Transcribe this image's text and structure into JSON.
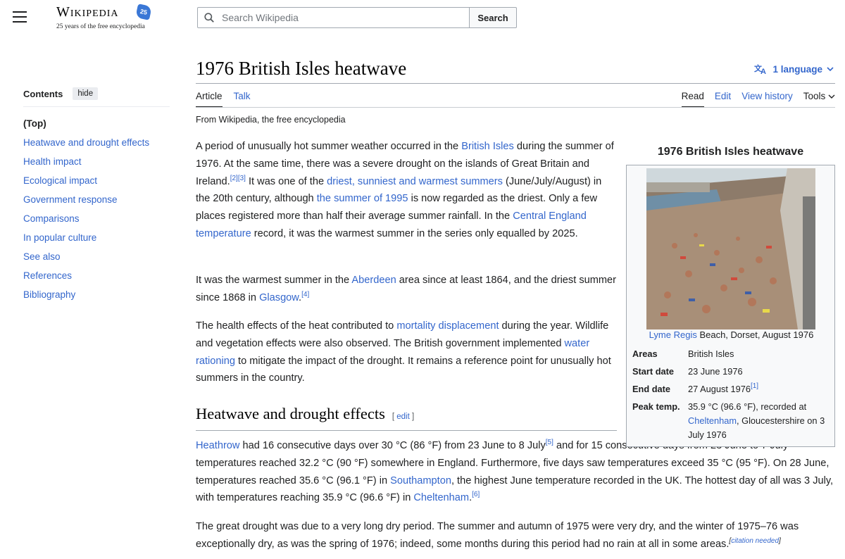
{
  "header": {
    "logo_word": "Wikipedia",
    "logo_badge": "25",
    "logo_tagline": "25 years of the free encyclopedia",
    "search_placeholder": "Search Wikipedia",
    "search_button": "Search"
  },
  "sidebar": {
    "contents_label": "Contents",
    "hide_label": "hide",
    "items": [
      {
        "label": "(Top)"
      },
      {
        "label": "Heatwave and drought effects"
      },
      {
        "label": "Health impact"
      },
      {
        "label": "Ecological impact"
      },
      {
        "label": "Government response"
      },
      {
        "label": "Comparisons"
      },
      {
        "label": "In popular culture"
      },
      {
        "label": "See also"
      },
      {
        "label": "References"
      },
      {
        "label": "Bibliography"
      }
    ]
  },
  "page": {
    "title": "1976 British Isles heatwave",
    "language_button": "1 language",
    "tabs_left": [
      "Article",
      "Talk"
    ],
    "tabs_right": [
      "Read",
      "Edit",
      "View history",
      "Tools"
    ],
    "tagline": "From Wikipedia, the free encyclopedia"
  },
  "article": {
    "p1": {
      "t1": "A period of unusually hot summer weather occurred in the ",
      "l1": "British Isles",
      "t2": " during the summer of 1976. At the same time, there was a severe drought on the islands of Great Britain and Ireland.",
      "s1": "[2]",
      "s2": "[3]",
      "t3": " It was one of the ",
      "l2": "driest, sunniest and warmest summers",
      "t4": " (June/July/August) in the 20th century, although ",
      "l3": "the summer of 1995",
      "t5": " is now regarded as the driest. Only a few places registered more than half their average summer rainfall. In the ",
      "l4": "Central England temperature",
      "t6": " record, it was the warmest summer in the series only equalled by 2025."
    },
    "p2": {
      "t1": "It was the warmest summer in the ",
      "l1": "Aberdeen",
      "t2": " area since at least 1864, and the driest summer since 1868 in ",
      "l2": "Glasgow",
      "t3": ".",
      "s1": "[4]"
    },
    "p3": {
      "t1": "The health effects of the heat contributed to ",
      "l1": "mortality displacement",
      "t2": " during the year. Wildlife and vegetation effects were also observed. The British government implemented ",
      "l2": "water rationing",
      "t3": " to mitigate the impact of the drought. It remains a reference point for unusually hot summers in the country."
    },
    "section1": {
      "heading": "Heatwave and drought effects",
      "edit_open": "[ ",
      "edit_label": "edit",
      "edit_close": " ]"
    },
    "p4": {
      "l1": "Heathrow",
      "t1": " had 16 consecutive days over 30 °C (86 °F) from 23 June to 8 July",
      "s1": "[5]",
      "t2": " and for 15 consecutive days from 23 June to 7 July temperatures reached 32.2 °C (90 °F) somewhere in England. Furthermore, five days saw temperatures exceed 35 °C (95 °F). On 28 June, temperatures reached 35.6 °C (96.1 °F) in ",
      "l2": "Southampton",
      "t3": ", the highest June temperature recorded in the UK. The hottest day of all was 3 July, with temperatures reaching 35.9 °C (96.6 °F) in ",
      "l3": "Cheltenham",
      "t4": ".",
      "s2": "[6]"
    },
    "p5": {
      "t1": "The great drought was due to a very long dry period. The summer and autumn of 1975 were very dry, and the winter of 1975–76 was exceptionally dry, as was the spring of 1976; indeed, some months during this period had no rain at all in some areas.",
      "s_open": "[",
      "s_link": "citation needed",
      "s_close": "]"
    }
  },
  "infobox": {
    "title": "1976 British Isles heatwave",
    "caption_link": "Lyme Regis",
    "caption_text": " Beach, Dorset, August 1976",
    "rows": {
      "areas": {
        "key": "Areas",
        "value": "British Isles"
      },
      "start": {
        "key": "Start date",
        "value": "23 June 1976"
      },
      "end": {
        "key": "End date",
        "value": "27 August 1976",
        "sup": "[1]"
      },
      "peak": {
        "key": "Peak temp.",
        "v1": "35.9 °C (96.6 °F), recorded at ",
        "link": "Cheltenham",
        "v2": ", Gloucestershire on 3 July 1976"
      }
    }
  },
  "colors": {
    "link": "#3366cc",
    "text": "#202122",
    "infobox_bg": "#f8f9fa",
    "border": "#a2a9b1"
  }
}
